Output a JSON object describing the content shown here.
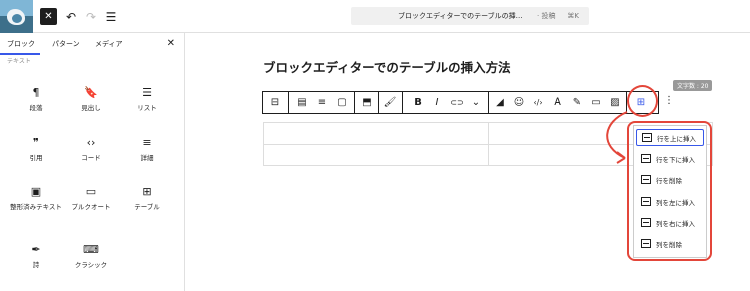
{
  "topbar": {
    "close_label": "✕",
    "undo_label": "↶",
    "redo_label": "↷",
    "listview_label": "☰",
    "command_title": "ブロックエディターでのテーブルの挿…",
    "command_type": "· 投稿",
    "command_shortcut": "⌘K"
  },
  "sidebar": {
    "tabs": [
      "ブロック",
      "パターン",
      "メディア"
    ],
    "close_label": "✕",
    "section_label": "テキスト",
    "blocks": [
      {
        "icon": "¶",
        "label": "段落"
      },
      {
        "icon": "🔖",
        "label": "見出し"
      },
      {
        "icon": "☰",
        "label": "リスト"
      },
      {
        "icon": "❞",
        "label": "引用"
      },
      {
        "icon": "‹›",
        "label": "コード"
      },
      {
        "icon": "≡",
        "label": "詳細"
      },
      {
        "icon": "▣",
        "label": "整形済みテキスト"
      },
      {
        "icon": "▭",
        "label": "プルクオート"
      },
      {
        "icon": "⊞",
        "label": "テーブル"
      },
      {
        "icon": "✒",
        "label": "詩"
      },
      {
        "icon": "⌨",
        "label": "クラシック"
      }
    ]
  },
  "editor": {
    "title": "ブロックエディターでのテーブルの挿入方法",
    "word_count": "文字数 : 20"
  },
  "toolbar": {
    "items": [
      "⊟",
      "▤",
      "≡",
      "▢",
      "⬒",
      "🖌",
      "B",
      "I",
      "⊂⊃",
      "⌄",
      "◢",
      "☺",
      "‹/›",
      "Ꭺ",
      "✎",
      "▭",
      "▨",
      "⊞",
      "⋮"
    ]
  },
  "table_menu": {
    "items": [
      "行を上に挿入",
      "行を下に挿入",
      "行を削除",
      "列を左に挿入",
      "列を右に挿入",
      "列を削除"
    ]
  },
  "colors": {
    "accent": "#3858e9",
    "annotation": "#e3463a"
  }
}
